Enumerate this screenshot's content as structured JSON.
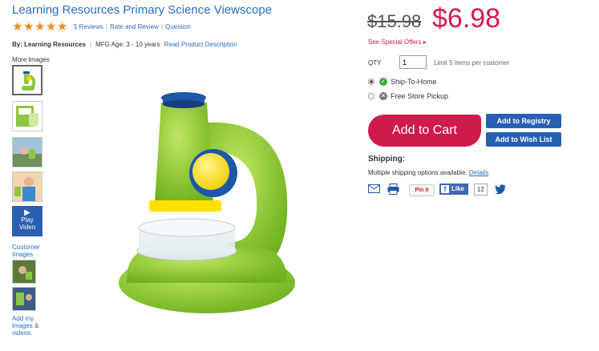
{
  "product": {
    "title": "Learning Resources Primary Science Viewscope",
    "rating_stars": 5,
    "reviews": "5 Reviews",
    "rate_review": "Rate and Review",
    "question": "Question",
    "by": "By: Learning Resources",
    "mfg_age": "MFG Age: 3 - 10 years",
    "read_desc": "Read Product Description"
  },
  "gallery": {
    "more_images": "More Images",
    "play_video": "Play",
    "play_video_2": "Video",
    "customer_images": "Customer Images",
    "add_images": "Add my images & videos"
  },
  "pricing": {
    "old_price": "$15.98",
    "price": "$6.98",
    "special_offers": "See Special Offers ▸"
  },
  "purchase": {
    "qty_label": "QTY",
    "qty_value": "1",
    "qty_limit": "Limit 5 Items per customer",
    "ship_home": "Ship-To-Home",
    "store_pickup": "Free Store Pickup",
    "add_to_cart": "Add to Cart",
    "add_registry": "Add to Registry",
    "add_wishlist": "Add to Wish List"
  },
  "shipping": {
    "heading": "Shipping:",
    "info": "Multiple shipping options available.",
    "details": "Details"
  },
  "social": {
    "pinit": "Pin it",
    "like": "Like",
    "like_count": "12"
  },
  "colors": {
    "brand_blue": "#2a6ebb",
    "price_red": "#d21b4e",
    "star_orange": "#f0891c"
  }
}
